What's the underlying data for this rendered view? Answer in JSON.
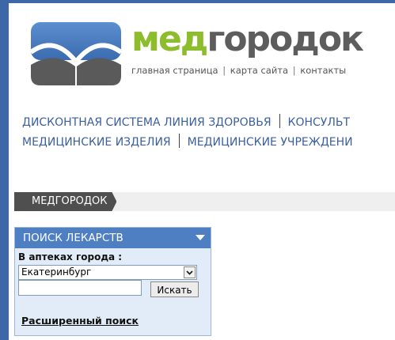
{
  "brand": {
    "name_part1": "мед",
    "name_part2": "городок",
    "colors": {
      "green": "#8dbc2d",
      "gray": "#5d5d5d",
      "blue": "#3d67a6"
    }
  },
  "top_links": {
    "home": "главная страница",
    "sitemap": "карта сайта",
    "contacts": "контакты",
    "separator": "|"
  },
  "categories": {
    "row1": [
      "ДИСКОНТНАЯ СИСТЕМА ЛИНИЯ ЗДОРОВЬЯ",
      "КОНСУЛЬТ"
    ],
    "row2": [
      "МЕДИЦИНСКИЕ ИЗДЕЛИЯ",
      "МЕДИЦИНСКИЕ УЧРЕЖДЕНИ"
    ]
  },
  "breadcrumb": {
    "current": "МЕДГОРОДОК"
  },
  "drug_search": {
    "title": "ПОИСК ЛЕКАРСТВ",
    "city_label": "В аптеках города :",
    "city_selected": "Екатеринбург",
    "query_value": "",
    "search_button": "Искать",
    "advanced_link": "Расширенный поиск"
  },
  "icons": {
    "logo": "open-book-logo-icon",
    "panel_toggle": "triangle-down-icon",
    "select_arrow": "chevron-down-icon"
  }
}
